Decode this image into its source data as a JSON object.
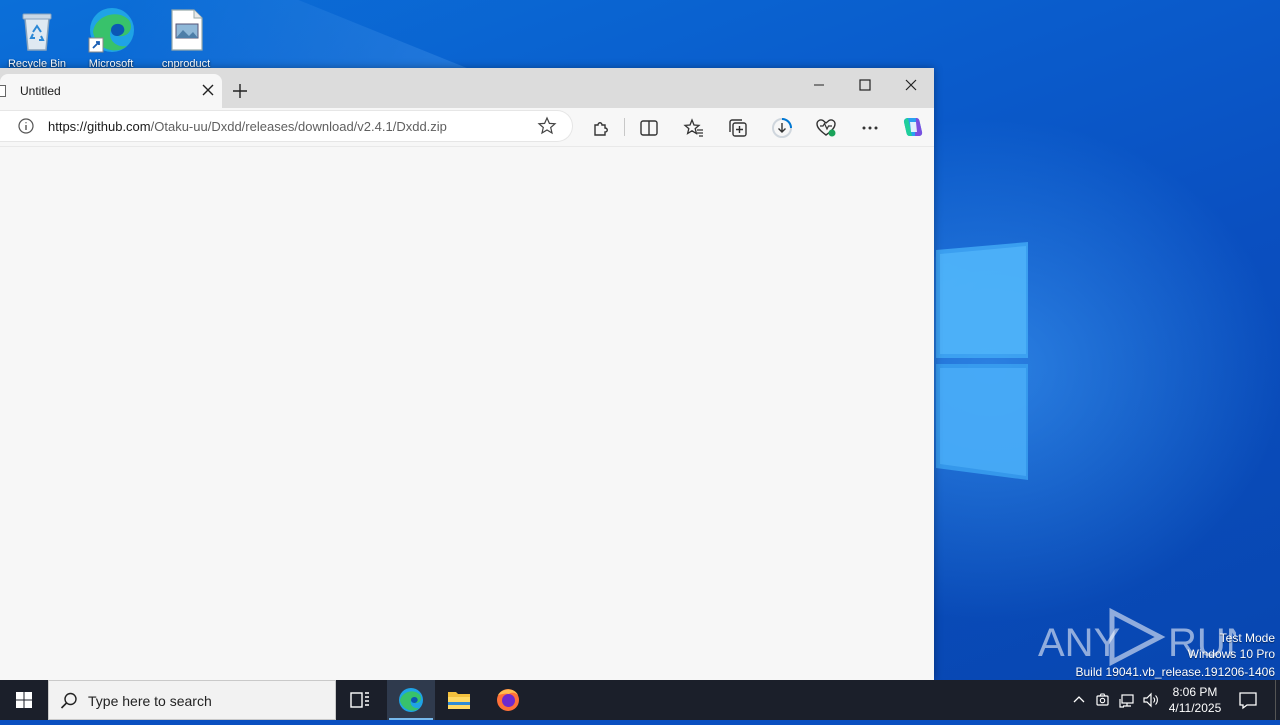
{
  "desktop": {
    "icons": [
      {
        "label": "Recycle Bin",
        "icon": "recycle-bin-icon"
      },
      {
        "label": "Microsoft",
        "icon": "edge-shortcut-icon"
      },
      {
        "label": "cnproduct",
        "icon": "image-file-icon"
      }
    ],
    "watermark": {
      "brand": "ANY RUN",
      "line1": "Test Mode",
      "line2": "Windows 10 Pro",
      "line3": "Build 19041.vb_release.191206-1406"
    }
  },
  "browser": {
    "tab_title": "Untitled",
    "url_host": "https://github.com",
    "url_path": "/Otaku-uu/Dxdd/releases/download/v2.4.1/Dxdd.zip",
    "window_controls": [
      "minimize",
      "maximize",
      "close"
    ],
    "toolbar_icons": [
      "extensions-icon",
      "split-screen-icon",
      "favorites-icon",
      "collections-icon",
      "downloads-icon",
      "browser-essentials-icon",
      "more-icon",
      "copilot-icon"
    ]
  },
  "taskbar": {
    "search_placeholder": "Type here to search",
    "apps": [
      "task-view-icon",
      "edge-icon",
      "file-explorer-icon",
      "firefox-icon"
    ],
    "time": "8:06 PM",
    "date": "4/11/2025"
  },
  "colors": {
    "accent": "#0078d4",
    "taskbar": "#1b1f2a",
    "desktop": "#0a5ccc"
  }
}
